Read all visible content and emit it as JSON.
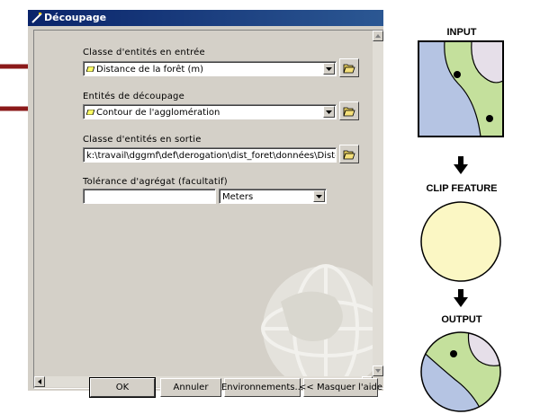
{
  "window": {
    "title": "Découpage"
  },
  "form": {
    "input_label": "Classe d'entités en entrée",
    "input_value": "Distance de la forêt (m)",
    "clip_label": "Entités de découpage",
    "clip_value": "Contour de l'agglomération",
    "output_label": "Classe d'entités en sortie",
    "output_value": "k:\\travail\\dggmf\\def\\derogation\\dist_foret\\données\\Dist-foret",
    "tolerance_label": "Tolérance d'agrégat (facultatif)",
    "tolerance_value": "",
    "units_value": "Meters"
  },
  "buttons": {
    "ok": "OK",
    "cancel": "Annuler",
    "environments": "Environnements...",
    "hide_help": "<< Masquer l'aide"
  },
  "help": {
    "input_title": "INPUT",
    "clip_title": "CLIP FEATURE",
    "output_title": "OUTPUT"
  },
  "colors": {
    "titlebar": "#0a246a",
    "annotation_arrow": "#8b1a1a",
    "map_blue": "#b5c4e3",
    "map_green": "#c4e09c",
    "map_lilac": "#e6dfe9",
    "clip_fill": "#fbf7c4"
  }
}
